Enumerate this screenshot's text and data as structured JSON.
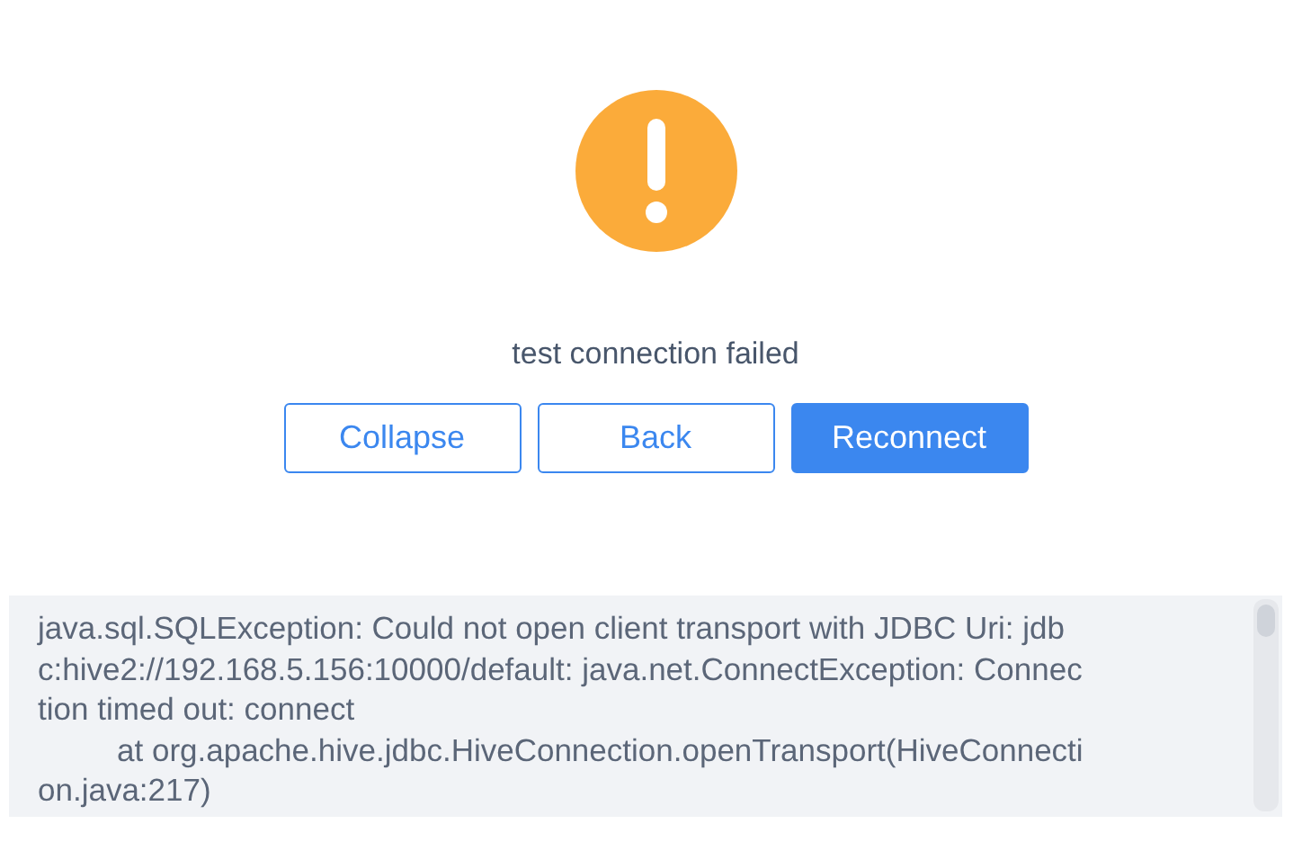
{
  "status": {
    "kind": "warning",
    "message": "test connection failed"
  },
  "buttons": [
    {
      "label": "Collapse",
      "kind": "default"
    },
    {
      "label": "Back",
      "kind": "default"
    },
    {
      "label": "Reconnect",
      "kind": "primary"
    }
  ],
  "log": {
    "lines": [
      {
        "text": "java.sql.SQLException: Could not open client transport with JDBC Uri: jdb",
        "indented": false
      },
      {
        "text": "c:hive2://192.168.5.156:10000/default: java.net.ConnectException: Connec",
        "indented": false
      },
      {
        "text": "tion timed out: connect",
        "indented": false
      },
      {
        "text": "at org.apache.hive.jdbc.HiveConnection.openTransport(HiveConnecti",
        "indented": true
      },
      {
        "text": "on.java:217)",
        "indented": false
      }
    ]
  }
}
